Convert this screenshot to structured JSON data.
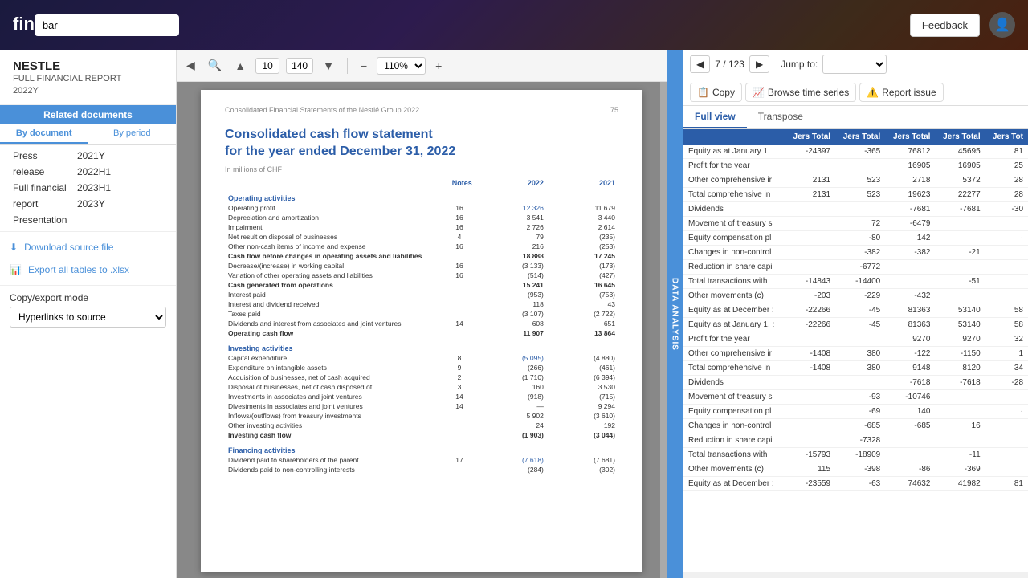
{
  "app": {
    "logo": "fin",
    "search_value": "bar",
    "feedback_label": "Feedback"
  },
  "sidebar": {
    "company_name": "NESTLE",
    "company_subtitle": "FULL FINANCIAL REPORT\n2022Y",
    "related_docs_label": "Related documents",
    "tabs": [
      {
        "id": "by_document",
        "label": "By document",
        "active": true
      },
      {
        "id": "by_period",
        "label": "By period",
        "active": false
      }
    ],
    "documents": [
      {
        "type": "Press",
        "year": "2021Y"
      },
      {
        "type": "release",
        "year": "2022H1"
      },
      {
        "type": "Full financial",
        "year": "2023H1"
      },
      {
        "type": "report",
        "year": "2023Y"
      },
      {
        "type": "Presentation",
        "year": ""
      }
    ],
    "download_label": "Download source file",
    "export_label": "Export all tables to .xlsx",
    "copy_mode_label": "Copy/export mode",
    "copy_mode_option": "Hyperlinks to source"
  },
  "data_analysis_tab": "DATA ANALYSIS",
  "doc_viewer": {
    "page_number": "10",
    "total_indicator": "140",
    "zoom_level": "110%",
    "page_header_left": "Consolidated Financial Statements of the Nestlé Group 2022",
    "page_header_right": "75",
    "doc_title_line1": "Consolidated cash flow statement",
    "doc_title_line2": "for the year ended December 31, 2022",
    "currency_note": "In millions of CHF",
    "col_notes": "Notes",
    "col_2022": "2022",
    "col_2021": "2021",
    "sections": [
      {
        "type": "section_header",
        "label": "Operating activities"
      },
      {
        "label": "Operating profit",
        "notes": "16",
        "val2022": "12 326",
        "val2021": "11 679",
        "blue": true
      },
      {
        "label": "Depreciation and amortization",
        "notes": "16",
        "val2022": "3 541",
        "val2021": "3 440"
      },
      {
        "label": "Impairment",
        "notes": "16",
        "val2022": "2 726",
        "val2021": "2 614"
      },
      {
        "label": "Net result on disposal of businesses",
        "notes": "4",
        "val2022": "79",
        "val2021": "(235)"
      },
      {
        "label": "Other non-cash items of income and expense",
        "notes": "16",
        "val2022": "216",
        "val2021": "(253)"
      },
      {
        "type": "subtotal",
        "label": "Cash flow before changes in operating assets and liabilities",
        "val2022": "18 888",
        "val2021": "17 245"
      },
      {
        "label": "Decrease/(increase) in working capital",
        "notes": "16",
        "val2022": "(3 133)",
        "val2021": "(173)"
      },
      {
        "label": "Variation of other operating assets and liabilities",
        "notes": "16",
        "val2022": "(514)",
        "val2021": "(427)"
      },
      {
        "type": "subtotal",
        "label": "Cash generated from operations",
        "val2022": "15 241",
        "val2021": "16 645"
      },
      {
        "label": "Interest paid",
        "val2022": "(953)",
        "val2021": "(753)"
      },
      {
        "label": "Interest and dividend received",
        "val2022": "118",
        "val2021": "43"
      },
      {
        "label": "Taxes paid",
        "val2022": "(3 107)",
        "val2021": "(2 722)"
      },
      {
        "label": "Dividends and interest from associates and joint ventures",
        "notes": "14",
        "val2022": "608",
        "val2021": "651"
      },
      {
        "type": "subtotal",
        "label": "Operating cash flow",
        "val2022": "11 907",
        "val2021": "13 864"
      },
      {
        "type": "section_header",
        "label": "Investing activities"
      },
      {
        "label": "Capital expenditure",
        "notes": "8",
        "val2022": "(5 095)",
        "val2021": "(4 880)",
        "blue": true
      },
      {
        "label": "Expenditure on intangible assets",
        "notes": "9",
        "val2022": "(266)",
        "val2021": "(461)"
      },
      {
        "label": "Acquisition of businesses, net of cash acquired",
        "notes": "2",
        "val2022": "(1 710)",
        "val2021": "(6 394)"
      },
      {
        "label": "Disposal of businesses, net of cash disposed of",
        "notes": "3",
        "val2022": "160",
        "val2021": "3 530"
      },
      {
        "label": "Investments in associates and joint ventures",
        "notes": "14",
        "val2022": "(918)",
        "val2021": "(715)"
      },
      {
        "label": "Divestments in associates and joint ventures",
        "notes": "14",
        "val2022": "—",
        "val2021": "9 294"
      },
      {
        "label": "Inflows/(outflows) from treasury investments",
        "val2022": "5 902",
        "val2021": "(3 610)"
      },
      {
        "label": "Other investing activities",
        "val2022": "24",
        "val2021": "192"
      },
      {
        "type": "subtotal",
        "label": "Investing cash flow",
        "val2022": "(1 903)",
        "val2021": "(3 044)"
      },
      {
        "type": "section_header",
        "label": "Financing activities"
      },
      {
        "label": "Dividend paid to shareholders of the parent",
        "notes": "17",
        "val2022": "(7 618)",
        "val2021": "(7 681)",
        "blue": true
      },
      {
        "label": "Dividends paid to non-controlling interests",
        "val2022": "(284)",
        "val2021": "(302)"
      }
    ]
  },
  "right_panel": {
    "current_page": "7",
    "total_pages": "123",
    "jump_label": "Jump to:",
    "actions": [
      {
        "id": "copy",
        "label": "Copy",
        "icon": "📋"
      },
      {
        "id": "browse_time_series",
        "label": "Browse time series",
        "icon": "📈"
      },
      {
        "id": "report_issue",
        "label": "Report issue",
        "icon": "⚠️"
      }
    ],
    "view_tabs": [
      {
        "id": "full_view",
        "label": "Full view",
        "active": true
      },
      {
        "id": "transpose",
        "label": "Transpose",
        "active": false
      }
    ],
    "table_headers": [
      "",
      "Jers Total",
      "Jers Total",
      "Jers Total",
      "Jers Total",
      "Jers Tot"
    ],
    "rows": [
      {
        "label": "Equity as at January 1,",
        "cols": [
          "-24397",
          "-365",
          "76812",
          "45695",
          "81"
        ]
      },
      {
        "label": "Profit for the year",
        "cols": [
          "",
          "",
          "16905",
          "16905",
          "25"
        ]
      },
      {
        "label": "Other comprehensive ir",
        "cols": [
          "2131",
          "523",
          "2718",
          "5372",
          "28"
        ]
      },
      {
        "label": "Total comprehensive in",
        "cols": [
          "2131",
          "523",
          "19623",
          "22277",
          "28"
        ]
      },
      {
        "label": "Dividends",
        "cols": [
          "",
          "",
          "-7681",
          "-7681",
          "-30"
        ]
      },
      {
        "label": "Movement of treasury s",
        "cols": [
          "",
          "72",
          "-6479",
          "",
          ""
        ]
      },
      {
        "label": "Equity compensation pl",
        "cols": [
          "",
          "-80",
          "142",
          "",
          "·"
        ]
      },
      {
        "label": "Changes in non-control",
        "cols": [
          "",
          "-382",
          "-382",
          "-21",
          ""
        ]
      },
      {
        "label": "Reduction in share capi",
        "cols": [
          "",
          "-6772",
          "",
          "",
          ""
        ]
      },
      {
        "label": "Total transactions with",
        "cols": [
          "-14843",
          "-14400",
          "",
          "-51",
          ""
        ]
      },
      {
        "label": "Other movements (c)",
        "cols": [
          "-203",
          "-229",
          "-432",
          "",
          ""
        ]
      },
      {
        "label": "Equity as at December :",
        "cols": [
          "-22266",
          "-45",
          "81363",
          "53140",
          "58"
        ]
      },
      {
        "label": "Equity as at January 1, :",
        "cols": [
          "-22266",
          "-45",
          "81363",
          "53140",
          "58"
        ]
      },
      {
        "label": "Profit for the year",
        "cols": [
          "",
          "",
          "9270",
          "9270",
          "32"
        ]
      },
      {
        "label": "Other comprehensive ir",
        "cols": [
          "-1408",
          "380",
          "-122",
          "-1150",
          "1"
        ]
      },
      {
        "label": "Total comprehensive in",
        "cols": [
          "-1408",
          "380",
          "9148",
          "8120",
          "34"
        ]
      },
      {
        "label": "Dividends",
        "cols": [
          "",
          "",
          "-7618",
          "-7618",
          "-28"
        ]
      },
      {
        "label": "Movement of treasury s",
        "cols": [
          "",
          "-93",
          "-10746",
          "",
          ""
        ]
      },
      {
        "label": "Equity compensation pl",
        "cols": [
          "",
          "-69",
          "140",
          "",
          "·"
        ]
      },
      {
        "label": "Changes in non-control",
        "cols": [
          "",
          "-685",
          "-685",
          "16",
          ""
        ]
      },
      {
        "label": "Reduction in share capi",
        "cols": [
          "",
          "-7328",
          "",
          "",
          ""
        ]
      },
      {
        "label": "Total transactions with",
        "cols": [
          "-15793",
          "-18909",
          "",
          "-11",
          ""
        ]
      },
      {
        "label": "Other movements (c)",
        "cols": [
          "115",
          "-398",
          "-86",
          "-369",
          ""
        ]
      },
      {
        "label": "Equity as at December :",
        "cols": [
          "-23559",
          "-63",
          "74632",
          "41982",
          "81"
        ]
      }
    ]
  }
}
